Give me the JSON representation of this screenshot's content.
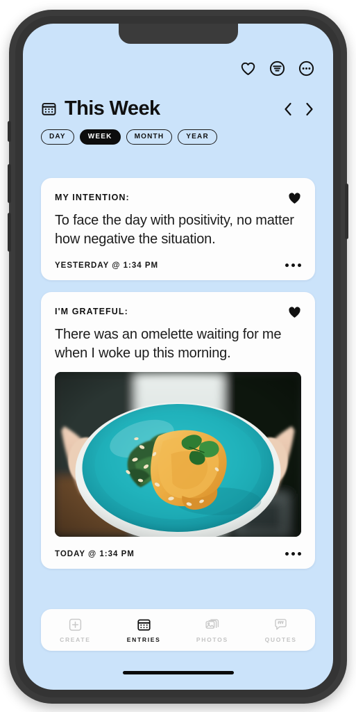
{
  "theme": {
    "screen_bg": "#cbe3fa",
    "card_bg": "#fdfdfd",
    "accent_dark": "#0d0d0d",
    "frame": "#3b3b3b",
    "inactive_tab": "#c3c3c3"
  },
  "top_bar": {
    "icons": [
      {
        "name": "heart-outline-icon",
        "label": "Favorites"
      },
      {
        "name": "filter-icon",
        "label": "Filter"
      },
      {
        "name": "more-options-icon",
        "label": "More"
      }
    ]
  },
  "header": {
    "calendar_icon": "calendar-icon",
    "title": "This Week",
    "prev_label": "Previous",
    "next_label": "Next",
    "range_pills": [
      {
        "label": "DAY",
        "active": false
      },
      {
        "label": "WEEK",
        "active": true
      },
      {
        "label": "MONTH",
        "active": false
      },
      {
        "label": "YEAR",
        "active": false
      }
    ]
  },
  "entries": [
    {
      "label": "MY INTENTION:",
      "body": "To face the day with positivity, no matter how negative the situation.",
      "timestamp": "YESTERDAY @ 1:34 PM",
      "favorited": true,
      "has_photo": false
    },
    {
      "label": "I'M GRATEFUL:",
      "body": "There was an omelette waiting for me when I woke up this morning.",
      "timestamp": "TODAY @ 1:34 PM",
      "favorited": true,
      "has_photo": true,
      "photo_alt": "Hands holding a teal bowl with an omelette, greens and basil"
    }
  ],
  "tabbar": {
    "tabs": [
      {
        "label": "CREATE",
        "icon": "plus-square-icon",
        "active": false
      },
      {
        "label": "ENTRIES",
        "icon": "calendar-icon",
        "active": true
      },
      {
        "label": "PHOTOS",
        "icon": "photos-stack-icon",
        "active": false
      },
      {
        "label": "QUOTES",
        "icon": "quote-bubble-icon",
        "active": false
      }
    ]
  }
}
